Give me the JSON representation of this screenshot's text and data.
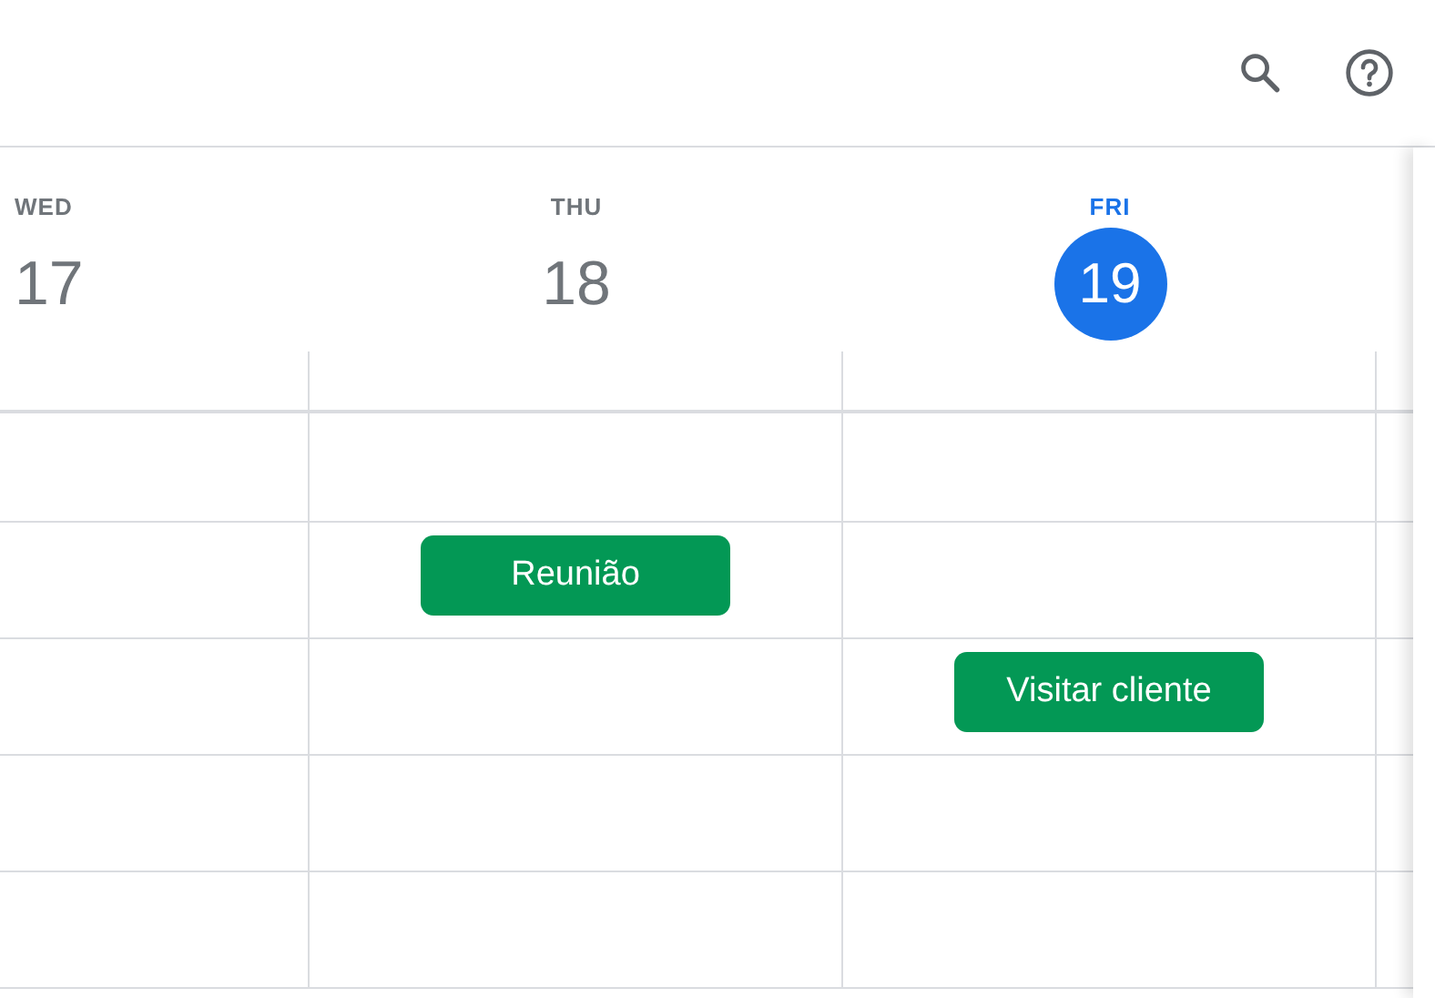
{
  "toolbar": {
    "buttons": [
      {
        "kind": "search"
      },
      {
        "kind": "help"
      }
    ]
  },
  "days": [
    {
      "weekday": "WED",
      "date": "17",
      "today": false
    },
    {
      "weekday": "THU",
      "date": "18",
      "today": false
    },
    {
      "weekday": "FRI",
      "date": "19",
      "today": true
    }
  ],
  "rows": [
    {
      "cells": [
        null,
        null,
        null,
        null
      ]
    },
    {
      "cells": [
        null,
        {
          "title": "Reunião"
        },
        null,
        null
      ]
    },
    {
      "cells": [
        null,
        null,
        {
          "title": "Visitar cliente"
        },
        null
      ]
    },
    {
      "cells": [
        null,
        null,
        null,
        null
      ]
    },
    {
      "cells": [
        null,
        null,
        null,
        null
      ]
    }
  ]
}
